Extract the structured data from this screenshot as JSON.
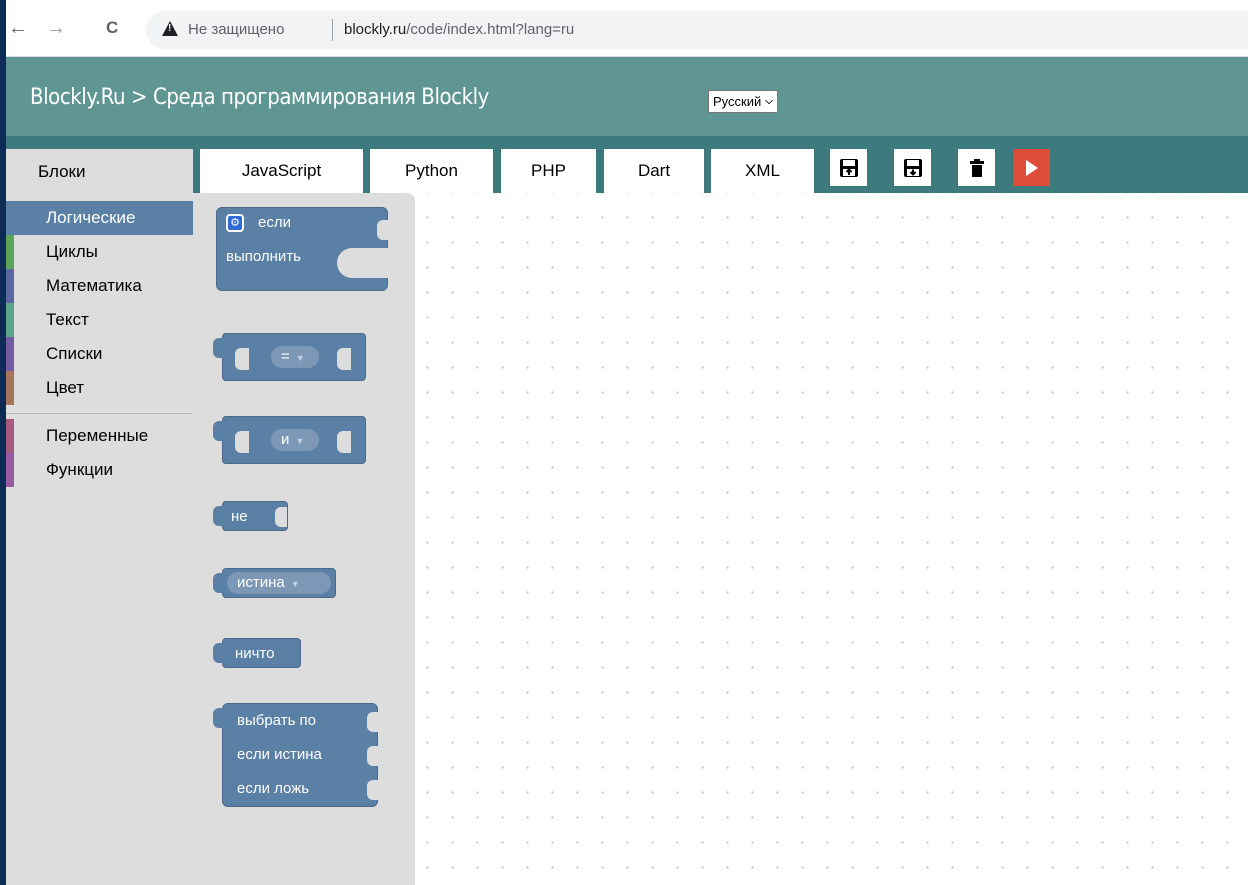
{
  "browser": {
    "back": "←",
    "forward": "→",
    "reload": "C",
    "security_label": "Не защищено",
    "url_host": "blockly.ru",
    "url_path": "/code/index.html?lang=ru"
  },
  "header": {
    "title": "Blockly.Ru  >  Среда программирования Blockly",
    "language": "Русский"
  },
  "toolbar": {
    "toolbox_title": "Блоки",
    "tabs": [
      "JavaScript",
      "Python",
      "PHP",
      "Dart",
      "XML"
    ],
    "icons": [
      "save-to-file-icon",
      "load-from-file-icon",
      "trash-icon",
      "run-icon"
    ],
    "run_color": "#dd4b39"
  },
  "categories": [
    {
      "label": "Логические",
      "color": "#5b80a5"
    },
    {
      "label": "Циклы",
      "color": "#5ba55b"
    },
    {
      "label": "Математика",
      "color": "#5b67a5"
    },
    {
      "label": "Текст",
      "color": "#5ba58c"
    },
    {
      "label": "Списки",
      "color": "#745ba5"
    },
    {
      "label": "Цвет",
      "color": "#a5745b"
    },
    {
      "label": "Переменные",
      "color": "#a55b80"
    },
    {
      "label": "Функции",
      "color": "#995ba5"
    }
  ],
  "flyout": {
    "if_block": {
      "line1": "если",
      "line2": "выполнить"
    },
    "compare_op": "=",
    "logic_op": "и",
    "negate": "не",
    "boolean": "истина",
    "null": "ничто",
    "ternary": {
      "line1": "выбрать по",
      "line2": "если истина",
      "line3": "если ложь"
    }
  },
  "colors": {
    "header": "#5f9694",
    "tabbar": "#3d7a7d",
    "logic_block": "#5b80a5"
  }
}
